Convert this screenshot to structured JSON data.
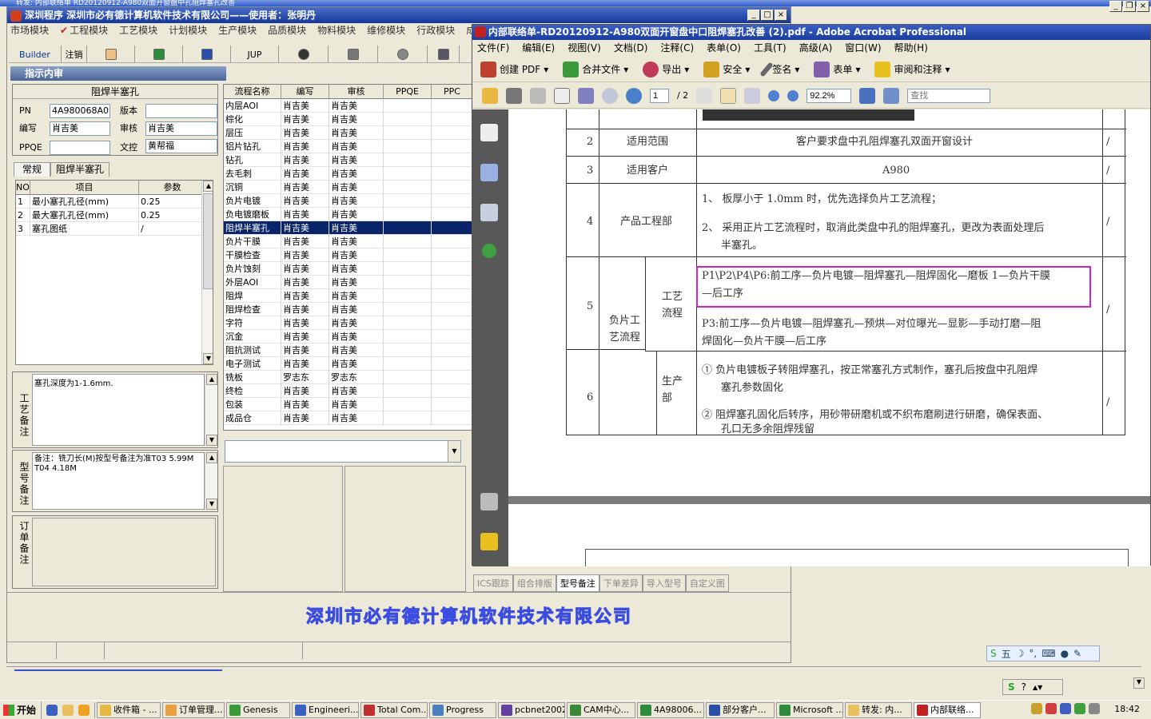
{
  "background_window": {
    "title_fragment": "转发: 内部联络单 RD20120912-A980双面开窗盘中孔阻焊塞孔改善"
  },
  "app": {
    "title": "深圳程序    深圳市必有德计算机软件技术有限公司——使用者：张明丹",
    "menu": [
      "市场模块",
      "工程模块",
      "工艺模块",
      "计划模块",
      "生产模块",
      "品质模块",
      "物料模块",
      "维修模块",
      "行政模块",
      "成"
    ],
    "toolbar": {
      "builder": "Builder",
      "logout": "注销",
      "jup": "JUP"
    },
    "subwindow_title": "指示内审",
    "section_title": "阻焊半塞孔",
    "form": {
      "pn_label": "PN",
      "pn_value": "4A980068A0",
      "version_label": "版本",
      "version_value": "",
      "author_label": "编写",
      "author_value": "肖吉美",
      "review_label": "审核",
      "review_value": "肖吉美",
      "ppqe_label": "PPQE",
      "ppqe_value": "",
      "doc_label": "文控",
      "doc_value": "黄帮福"
    },
    "tabs": [
      "常规",
      "阻焊半塞孔"
    ],
    "param_table": {
      "headers": [
        "NO",
        "项目",
        "参数"
      ],
      "rows": [
        [
          "1",
          "最小塞孔孔径(mm)",
          "0.25"
        ],
        [
          "2",
          "最大塞孔孔径(mm)",
          "0.25"
        ],
        [
          "3",
          "塞孔图纸",
          "/"
        ]
      ]
    },
    "notes": [
      {
        "label": "工艺备注",
        "text": "塞孔深度为1-1.6mm."
      },
      {
        "label": "型号备注",
        "text": "备注：铣刀长(M)按型号备注为准T03 5.99M T04 4.18M"
      },
      {
        "label": "订单备注",
        "text": ""
      }
    ],
    "process_table": {
      "headers": [
        "流程名称",
        "编写",
        "审核",
        "PPQE",
        "PPC"
      ],
      "rows": [
        [
          "内层AOI",
          "肖吉美",
          "肖吉美"
        ],
        [
          "棕化",
          "肖吉美",
          "肖吉美"
        ],
        [
          "层压",
          "肖吉美",
          "肖吉美"
        ],
        [
          "铝片钻孔",
          "肖吉美",
          "肖吉美"
        ],
        [
          "钻孔",
          "肖吉美",
          "肖吉美"
        ],
        [
          "去毛刺",
          "肖吉美",
          "肖吉美"
        ],
        [
          "沉铜",
          "肖吉美",
          "肖吉美"
        ],
        [
          "负片电镀",
          "肖吉美",
          "肖吉美"
        ],
        [
          "负电镀磨板",
          "肖吉美",
          "肖吉美"
        ],
        [
          "阻焊半塞孔",
          "肖吉美",
          "肖吉美"
        ],
        [
          "负片干膜",
          "肖吉美",
          "肖吉美"
        ],
        [
          "干膜检查",
          "肖吉美",
          "肖吉美"
        ],
        [
          "负片蚀刻",
          "肖吉美",
          "肖吉美"
        ],
        [
          "外层AOI",
          "肖吉美",
          "肖吉美"
        ],
        [
          "阻焊",
          "肖吉美",
          "肖吉美"
        ],
        [
          "阻焊检查",
          "肖吉美",
          "肖吉美"
        ],
        [
          "字符",
          "肖吉美",
          "肖吉美"
        ],
        [
          "沉金",
          "肖吉美",
          "肖吉美"
        ],
        [
          "阻抗测试",
          "肖吉美",
          "肖吉美"
        ],
        [
          "电子测试",
          "肖吉美",
          "肖吉美"
        ],
        [
          "铣板",
          "罗志东",
          "罗志东"
        ],
        [
          "终检",
          "肖吉美",
          "肖吉美"
        ],
        [
          "包装",
          "肖吉美",
          "肖吉美"
        ],
        [
          "成品仓",
          "肖吉美",
          "肖吉美"
        ]
      ],
      "selected_index": 9
    },
    "bottom_tabs": [
      "ICS跟踪",
      "组合排版",
      "型号备注",
      "下单差异",
      "导入型号",
      "自定义图"
    ],
    "active_bottom_tab": "型号备注",
    "banner": "深圳市必有德计算机软件技术有限公司"
  },
  "acrobat": {
    "title": "内部联络单-RD20120912-A980双面开窗盘中口阻焊塞孔改善 (2).pdf - Adobe Acrobat Professional",
    "menu": [
      "文件(F)",
      "编辑(E)",
      "视图(V)",
      "文档(D)",
      "注释(C)",
      "表单(O)",
      "工具(T)",
      "高级(A)",
      "窗口(W)",
      "帮助(H)"
    ],
    "toolbar1": [
      "创建 PDF",
      "合并文件",
      "导出",
      "安全",
      "签名",
      "表单",
      "审阅和注释"
    ],
    "page_current": "1",
    "page_total": "/ 2",
    "zoom": "92.2%",
    "search_placeholder": "查找",
    "doc": {
      "rows": [
        {
          "no": "2",
          "item": "适用范围",
          "content": "客户要求盘中孔阻焊塞孔双面开窗设计",
          "mark": "/"
        },
        {
          "no": "3",
          "item": "适用客户",
          "content": "A980",
          "mark": "/"
        },
        {
          "no": "4",
          "item": "产品工程部",
          "content1": "1、 板厚小于 1.0mm 时，优先选择负片工艺流程；",
          "content2": "2、 采用正片工艺流程时，取消此类盘中孔的阻焊塞孔，更改为表面处理后",
          "content3": "半塞孔。",
          "mark": "/"
        },
        {
          "no": "5",
          "item": "负片工艺流程",
          "sub": "工艺流程",
          "content1": "P1\\P2\\P4\\P6:前工序—负片电镀—阻焊塞孔—阻焊固化—磨板 1—负片干膜",
          "content2": "—后工序",
          "content3": "P3:前工序—负片电镀—阻焊塞孔—预烘—对位曝光—显影—手动打磨—阻",
          "content4": "焊固化—负片干膜—后工序",
          "mark": "/"
        },
        {
          "no": "6",
          "sub": "生产部",
          "content1": "① 负片电镀板子转阻焊塞孔，按正常塞孔方式制作，塞孔后按盘中孔阻焊",
          "content2": "塞孔参数固化",
          "content3": "② 阻焊塞孔固化后转序，用砂带研磨机或不织布磨刷进行研磨，确保表面、",
          "content4": "孔口无多余阻焊残留",
          "mark": "/"
        }
      ]
    }
  },
  "ime": {
    "label": "五"
  },
  "taskbar": {
    "start": "开始",
    "items": [
      "收件箱 - ...",
      "订单管理...",
      "Genesis",
      "Engineeri...",
      "Total Com...",
      "Progress",
      "pcbnet2002",
      "CAM中心...",
      "4A98006...",
      "部分客户...",
      "Microsoft ...",
      "转发: 内...",
      "内部联络..."
    ],
    "active_index": 12,
    "clock": "18:42"
  },
  "colors": {
    "selected_row": "#0a246a",
    "highlight_box": "#d020c8",
    "title_bar": "#1a3d9e"
  }
}
